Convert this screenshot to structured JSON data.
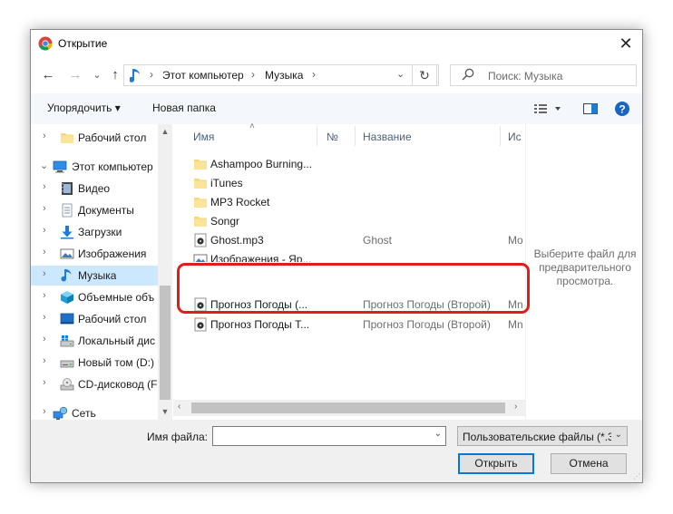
{
  "window": {
    "title": "Открытие",
    "close_glyph": "✕"
  },
  "nav": {
    "back_glyph": "←",
    "forward_glyph": "→",
    "dropdown_glyph": "⌄",
    "up_glyph": "↑",
    "refresh_glyph": "↻"
  },
  "address": {
    "segments": [
      "Этот компьютер",
      "Музыка"
    ],
    "separator": "›"
  },
  "search": {
    "placeholder": "Поиск: Музыка"
  },
  "toolbar": {
    "organize_label": "Упорядочить ▾",
    "new_folder_label": "Новая папка"
  },
  "sidebar": {
    "items": [
      {
        "label": "Рабочий стол",
        "icon": "folder-icon",
        "chevron": "›"
      },
      {
        "label": "Этот компьютер",
        "icon": "computer-icon",
        "chevron": "⌄"
      },
      {
        "label": "Видео",
        "icon": "video-icon",
        "chevron": "›"
      },
      {
        "label": "Документы",
        "icon": "documents-icon",
        "chevron": "›"
      },
      {
        "label": "Загрузки",
        "icon": "downloads-icon",
        "chevron": "›"
      },
      {
        "label": "Изображения",
        "icon": "pictures-icon",
        "chevron": "›"
      },
      {
        "label": "Музыка",
        "icon": "music-icon",
        "chevron": "›"
      },
      {
        "label": "Объемные объ",
        "icon": "3d-objects-icon",
        "chevron": "›"
      },
      {
        "label": "Рабочий стол",
        "icon": "desktop-icon",
        "chevron": "›"
      },
      {
        "label": "Локальный дис",
        "icon": "drive-icon",
        "chevron": "›"
      },
      {
        "label": "Новый том (D:)",
        "icon": "drive-icon",
        "chevron": "›"
      },
      {
        "label": "CD-дисковод (F",
        "icon": "cd-drive-icon",
        "chevron": "›"
      },
      {
        "label": "Сеть",
        "icon": "network-icon",
        "chevron": "›"
      }
    ]
  },
  "columns": {
    "name": "Имя",
    "number": "№",
    "title": "Название",
    "artist": "Ис"
  },
  "files": [
    {
      "name": "Ashampoo Burning...",
      "type": "folder",
      "title": "",
      "ext": ""
    },
    {
      "name": "iTunes",
      "type": "folder",
      "title": "",
      "ext": ""
    },
    {
      "name": "MP3 Rocket",
      "type": "folder",
      "title": "",
      "ext": ""
    },
    {
      "name": "Songr",
      "type": "folder",
      "title": "",
      "ext": ""
    },
    {
      "name": "Ghost.mp3",
      "type": "audio",
      "title": "Ghost",
      "ext": "Mo"
    },
    {
      "name": "Изображения - Яр...",
      "type": "shortcut",
      "title": "",
      "ext": ""
    },
    {
      "name": "Прогноз Погоды (...",
      "type": "audio",
      "title": "Прогноз Погоды (Второй)",
      "ext": "Mn"
    },
    {
      "name": "Прогноз Погоды Т...",
      "type": "audio",
      "title": "Прогноз Погоды (Второй)",
      "ext": "Mn"
    }
  ],
  "preview": {
    "text": "Выберите файл для предварительного просмотра."
  },
  "bottom": {
    "filename_label": "Имя файла:",
    "filename_value": "",
    "filetype_value": "Пользовательские файлы (*.3",
    "open_label": "Открыть",
    "cancel_label": "Отмена"
  },
  "colors": {
    "accent": "#0078d7",
    "selection": "#cce8ff",
    "highlight": "#e31b1b"
  }
}
